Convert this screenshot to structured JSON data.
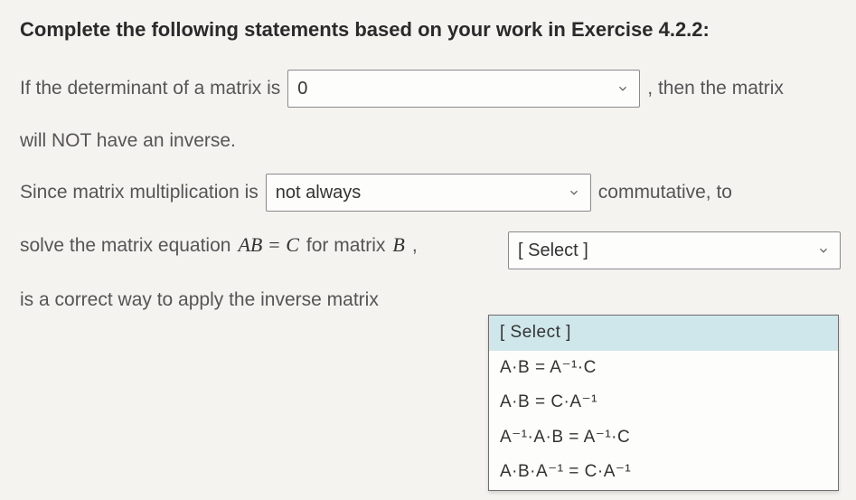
{
  "heading": "Complete the following statements based on your work in Exercise 4.2.2:",
  "s1": {
    "pre": "If the determinant of a matrix is",
    "value": "0",
    "post": ",  then the matrix",
    "line2": "will NOT have an inverse."
  },
  "s2": {
    "pre": "Since matrix multiplication is",
    "value": "not always",
    "post": "commutative, to"
  },
  "s3": {
    "pre1": "solve the matrix equation ",
    "eq": "AB = C",
    "pre2": " for matrix ",
    "eqvar": "B",
    "pre3": ",",
    "value": "[ Select ]",
    "line2": "is a correct way to apply the inverse matrix"
  },
  "dropdown": {
    "options": [
      "[ Select ]",
      "A·B = A⁻¹·C",
      "A·B = C·A⁻¹",
      "A⁻¹·A·B = A⁻¹·C",
      "A·B·A⁻¹ = C·A⁻¹"
    ]
  }
}
